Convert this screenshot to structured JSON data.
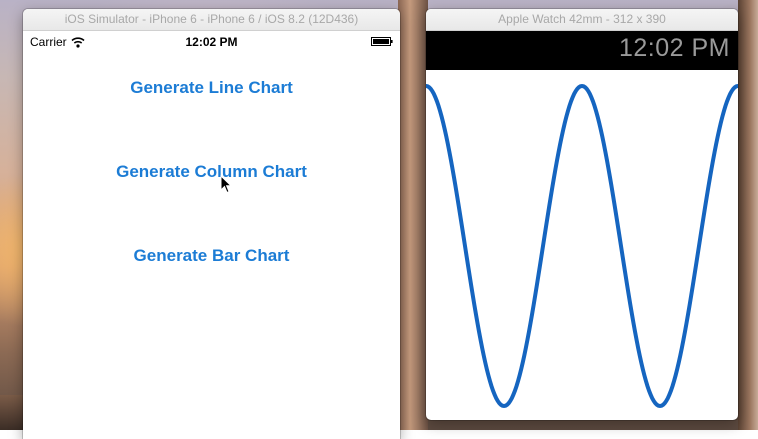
{
  "phone_window": {
    "title": "iOS Simulator - iPhone 6 - iPhone 6 / iOS 8.2 (12D436)",
    "status_bar": {
      "carrier": "Carrier",
      "time": "12:02 PM"
    },
    "buttons": [
      {
        "label": "Generate Line Chart"
      },
      {
        "label": "Generate Column Chart"
      },
      {
        "label": "Generate Bar Chart"
      }
    ],
    "accent_color": "#1c7cd5"
  },
  "watch_window": {
    "title": "Apple Watch 42mm - 312 x 390",
    "time": "12:02 PM"
  },
  "chart_data": {
    "type": "line",
    "function": "cosine",
    "cycles": 2,
    "x": [
      0,
      0.125,
      0.25,
      0.375,
      0.5,
      0.625,
      0.75,
      0.875,
      1.0
    ],
    "y": [
      1,
      0,
      -1,
      0,
      1,
      0,
      -1,
      0,
      1
    ],
    "ylim": [
      -1,
      1
    ],
    "color": "#1565c0",
    "grid": false,
    "title": "",
    "xlabel": "",
    "ylabel": ""
  }
}
